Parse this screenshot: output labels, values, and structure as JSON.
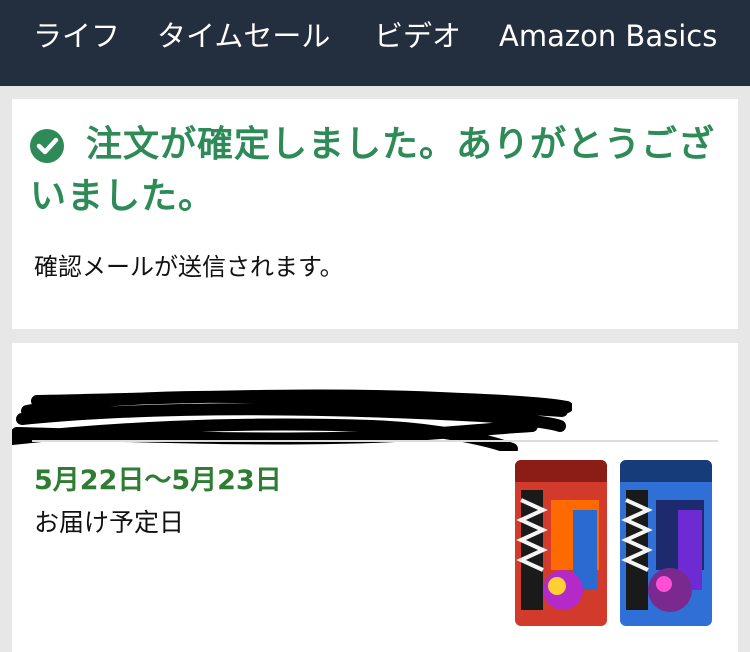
{
  "nav": {
    "items": [
      "ライフ",
      "タイムセール",
      "ビデオ",
      "Amazon Basics"
    ]
  },
  "confirmation": {
    "title": "注文が確定しました。ありがとうございました。",
    "message": "確認メールが送信されます。",
    "icon": "check-circle-icon",
    "accent_color": "#2e8b57"
  },
  "delivery": {
    "date": "5月22日〜5月23日",
    "label": "お届け予定日"
  },
  "products": [
    {
      "name": "product-thumbnail-1",
      "color": "#d23a2c"
    },
    {
      "name": "product-thumbnail-2",
      "color": "#2f6fd6"
    }
  ]
}
